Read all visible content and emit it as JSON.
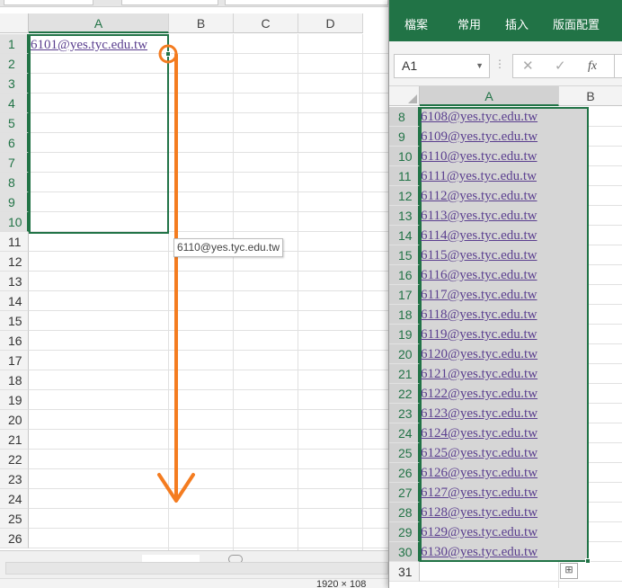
{
  "left": {
    "columns": [
      "A",
      "B",
      "C",
      "D"
    ],
    "rows": [
      "1",
      "2",
      "3",
      "4",
      "5",
      "6",
      "7",
      "8",
      "9",
      "10",
      "11",
      "12",
      "13",
      "14",
      "15",
      "16",
      "17",
      "18",
      "19",
      "20",
      "21",
      "22",
      "23",
      "24",
      "25",
      "26"
    ],
    "cell_A1": "6101@yes.tyc.edu.tw",
    "drag_tooltip": "6110@yes.tyc.edu.tw",
    "status_dimensions": "1920 × 108",
    "colors": {
      "accent": "#217346",
      "arrow": "#f47c20",
      "link": "#5b3f8f"
    }
  },
  "right": {
    "ribbon_tabs": [
      "檔案",
      "常用",
      "插入",
      "版面配置"
    ],
    "name_box": "A1",
    "columns": [
      "A",
      "B"
    ],
    "rows": [
      {
        "num": "8",
        "value": "6108@yes.tyc.edu.tw"
      },
      {
        "num": "9",
        "value": "6109@yes.tyc.edu.tw"
      },
      {
        "num": "10",
        "value": "6110@yes.tyc.edu.tw"
      },
      {
        "num": "11",
        "value": "6111@yes.tyc.edu.tw"
      },
      {
        "num": "12",
        "value": "6112@yes.tyc.edu.tw"
      },
      {
        "num": "13",
        "value": "6113@yes.tyc.edu.tw"
      },
      {
        "num": "14",
        "value": "6114@yes.tyc.edu.tw"
      },
      {
        "num": "15",
        "value": "6115@yes.tyc.edu.tw"
      },
      {
        "num": "16",
        "value": "6116@yes.tyc.edu.tw"
      },
      {
        "num": "17",
        "value": "6117@yes.tyc.edu.tw"
      },
      {
        "num": "18",
        "value": "6118@yes.tyc.edu.tw"
      },
      {
        "num": "19",
        "value": "6119@yes.tyc.edu.tw"
      },
      {
        "num": "20",
        "value": "6120@yes.tyc.edu.tw"
      },
      {
        "num": "21",
        "value": "6121@yes.tyc.edu.tw"
      },
      {
        "num": "22",
        "value": "6122@yes.tyc.edu.tw"
      },
      {
        "num": "23",
        "value": "6123@yes.tyc.edu.tw"
      },
      {
        "num": "24",
        "value": "6124@yes.tyc.edu.tw"
      },
      {
        "num": "25",
        "value": "6125@yes.tyc.edu.tw"
      },
      {
        "num": "26",
        "value": "6126@yes.tyc.edu.tw"
      },
      {
        "num": "27",
        "value": "6127@yes.tyc.edu.tw"
      },
      {
        "num": "28",
        "value": "6128@yes.tyc.edu.tw"
      },
      {
        "num": "29",
        "value": "6129@yes.tyc.edu.tw"
      },
      {
        "num": "30",
        "value": "6130@yes.tyc.edu.tw"
      },
      {
        "num": "31",
        "value": ""
      }
    ],
    "icons": {
      "cancel": "cancel-icon",
      "enter": "enter-icon",
      "function": "fx-icon",
      "autofill": "auto-fill-options-icon"
    }
  }
}
